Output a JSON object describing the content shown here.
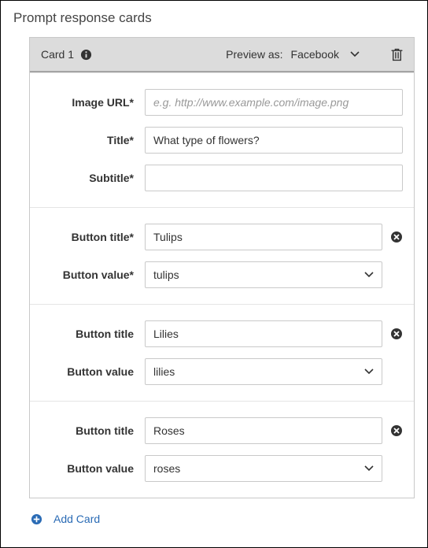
{
  "pageTitle": "Prompt response cards",
  "card": {
    "label": "Card 1",
    "previewLabel": "Preview as:",
    "previewValue": "Facebook",
    "fields": {
      "imageUrl": {
        "label": "Image URL*",
        "placeholder": "e.g. http://www.example.com/image.png",
        "value": ""
      },
      "title": {
        "label": "Title*",
        "placeholder": "",
        "value": "What type of flowers?"
      },
      "subtitle": {
        "label": "Subtitle*",
        "placeholder": "",
        "value": ""
      }
    },
    "buttons": [
      {
        "titleLabel": "Button title*",
        "valueLabel": "Button value*",
        "title": "Tulips",
        "value": "tulips"
      },
      {
        "titleLabel": "Button title",
        "valueLabel": "Button value",
        "title": "Lilies",
        "value": "lilies"
      },
      {
        "titleLabel": "Button title",
        "valueLabel": "Button value",
        "title": "Roses",
        "value": "roses"
      }
    ]
  },
  "addCardLabel": "Add Card"
}
